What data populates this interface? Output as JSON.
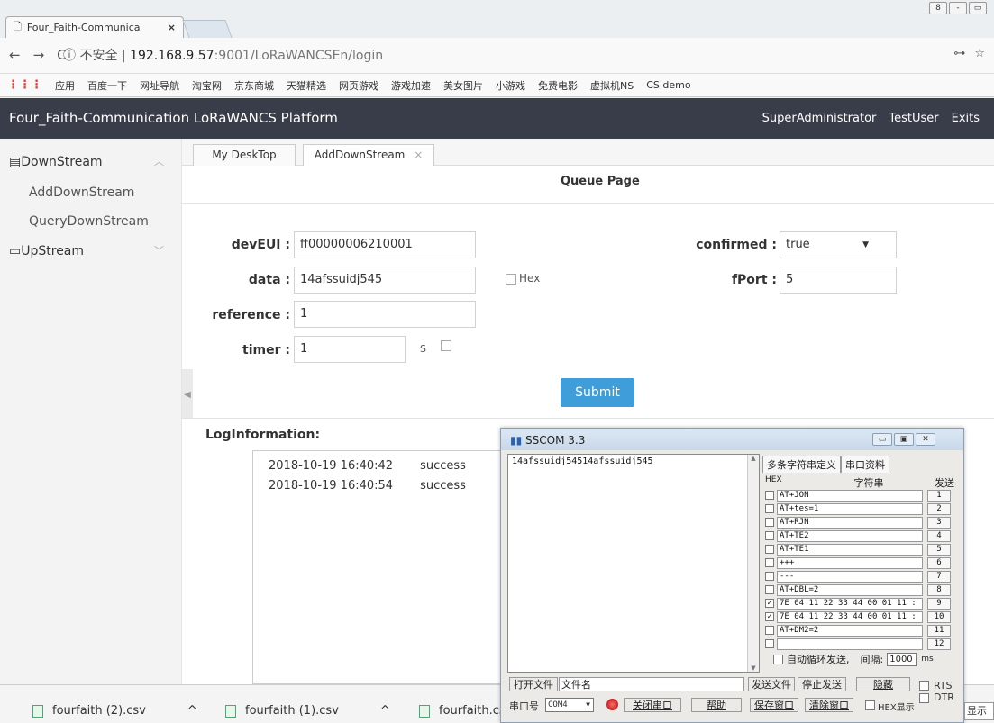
{
  "browser": {
    "tab_title": "Four_Faith-Communica",
    "tab_close": "×",
    "nav": {
      "back": "←",
      "forward": "→",
      "reload": "C"
    },
    "url_insecure": "ⓘ 不安全",
    "url_sep": "|",
    "url_host": "192.168.9.57",
    "url_path": ":9001/LoRaWANCSEn/login",
    "addr_icons": {
      "key": "⊶",
      "star": "☆"
    },
    "window_controls": [
      "8",
      "-",
      "▭"
    ],
    "bookmarks": [
      "应用",
      "百度一下",
      "网址导航",
      "淘宝网",
      "京东商城",
      "天猫精选",
      "网页游戏",
      "游戏加速",
      "美女图片",
      "小游戏",
      "免费电影",
      "虚拟机NS",
      "CS demo"
    ],
    "apps_icon": "⋮⋮⋮"
  },
  "header": {
    "title": "Four_Faith-Communication LoRaWANCS Platform",
    "links": [
      "SuperAdministrator",
      "TestUser",
      "Exits"
    ]
  },
  "sidebar": {
    "downstream": {
      "label": "DownStream",
      "icon": "▤",
      "chevron": "︿"
    },
    "items": [
      "AddDownStream",
      "QueryDownStream"
    ],
    "upstream": {
      "label": "UpStream",
      "icon": "▭",
      "chevron": "﹀"
    }
  },
  "content_tabs": [
    {
      "label": "My DeskTop"
    },
    {
      "label": "AddDownStream",
      "close": "×"
    }
  ],
  "form": {
    "title": "Queue Page",
    "devEUI": {
      "label": "devEUI :",
      "value": "ff00000006210001"
    },
    "data": {
      "label": "data :",
      "value": "14afssuidj545"
    },
    "hex_label": "Hex",
    "reference": {
      "label": "reference :",
      "value": "1"
    },
    "timer": {
      "label": "timer :",
      "value": "1",
      "unit": "S"
    },
    "confirmed": {
      "label": "confirmed :",
      "value": "true",
      "arrow": "▼"
    },
    "fPort": {
      "label": "fPort :",
      "value": "5"
    },
    "submit": "Submit",
    "collapse_arrow": "◀"
  },
  "log": {
    "label": "LogInformation:",
    "rows": [
      {
        "time": "2018-10-19 16:40:42",
        "status": "success"
      },
      {
        "time": "2018-10-19 16:40:54",
        "status": "success"
      }
    ]
  },
  "downloads": [
    {
      "name": "fourfaith (2).csv",
      "chevron": "^"
    },
    {
      "name": "fourfaith (1).csv",
      "chevron": "^"
    },
    {
      "name": "fourfaith.cs"
    }
  ],
  "sscom": {
    "title": "SSCOM 3.3",
    "win_controls": [
      "▭",
      "▣",
      "✕"
    ],
    "received": "14afssuidj54514afssuidj545",
    "tabs": [
      "多条字符串定义",
      "串口资料"
    ],
    "col_headers": {
      "hex": "HEX",
      "string": "字符串",
      "send": "发送"
    },
    "rows": [
      {
        "checked": false,
        "text": "AT+JON",
        "num": "1"
      },
      {
        "checked": false,
        "text": "AT+tes=1",
        "num": "2"
      },
      {
        "checked": false,
        "text": "AT+RJN",
        "num": "3"
      },
      {
        "checked": false,
        "text": "AT+TE2",
        "num": "4"
      },
      {
        "checked": false,
        "text": "AT+TE1",
        "num": "5"
      },
      {
        "checked": false,
        "text": "+++",
        "num": "6"
      },
      {
        "checked": false,
        "text": "---",
        "num": "7"
      },
      {
        "checked": false,
        "text": "AT+DBL=2",
        "num": "8"
      },
      {
        "checked": true,
        "text": "7E 04 11 22 33 44 00 01 11 :",
        "num": "9"
      },
      {
        "checked": true,
        "text": "7E 04 11 22 33 44 00 01 11 :",
        "num": "10"
      },
      {
        "checked": false,
        "text": "AT+DM2=2",
        "num": "11"
      },
      {
        "checked": false,
        "text": "",
        "num": "12"
      }
    ],
    "auto_loop": "自动循环发送,",
    "interval_label": "间隔:",
    "interval_value": "1000",
    "interval_unit": "ms",
    "open_file": "打开文件",
    "file_name": "文件名",
    "send_file": "发送文件",
    "stop_send": "停止发送",
    "hide": "隐藏",
    "rts": "RTS",
    "dtr": "DTR",
    "port_label": "串口号",
    "port_value": "COM4",
    "close_port": "关闭串口",
    "help": "帮助",
    "save_window": "保存窗口",
    "clear_window": "清除窗口",
    "hex_show": "HEX显示",
    "hint": "显示"
  }
}
